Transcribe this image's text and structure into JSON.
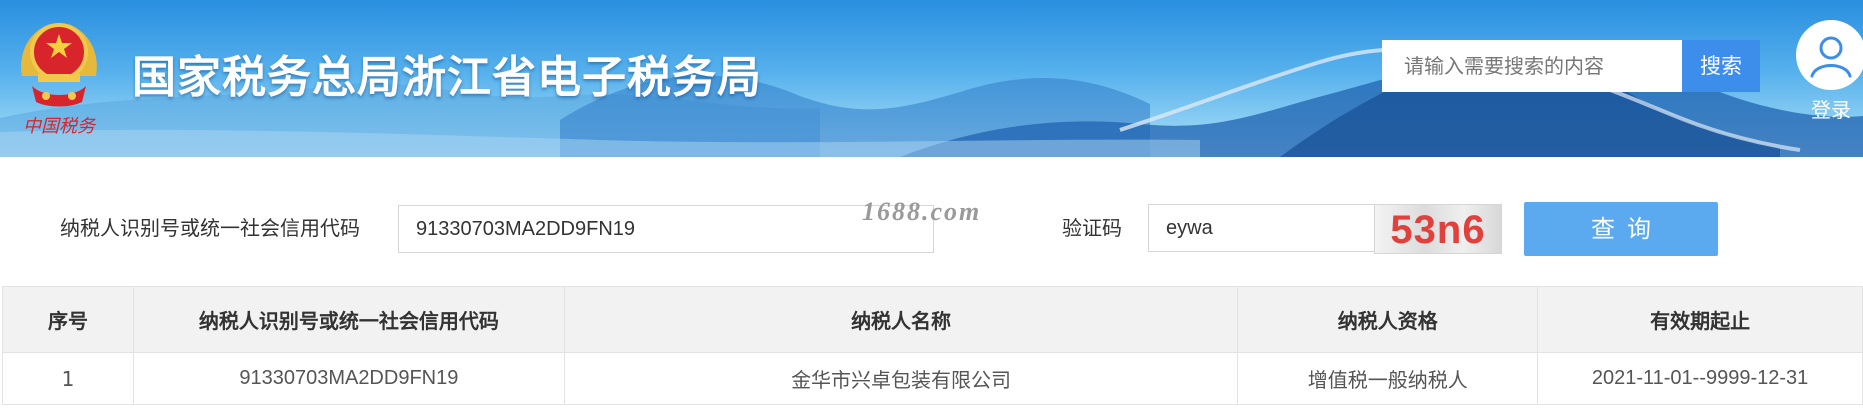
{
  "header": {
    "site_title": "国家税务总局浙江省电子税务局",
    "emblem_slogan": "中国税务",
    "search": {
      "placeholder": "请输入需要搜索的内容",
      "value": ""
    },
    "search_button": "搜索",
    "login_label": "登录",
    "colors": {
      "banner_top": "#2a8fe0",
      "banner_bottom": "#b6e1f8",
      "search_button": "#3d8eea"
    }
  },
  "query_form": {
    "taxpayer_id_label": "纳税人识别号或统一社会信用代码",
    "taxpayer_id_value": "91330703MA2DD9FN19",
    "watermark": "1688.com",
    "captcha_label": "验证码",
    "captcha_value": "eywa",
    "captcha_image_text": "53n6",
    "query_button": "查询",
    "colors": {
      "query_button": "#5baaf0",
      "captcha_text": "#e0413c"
    }
  },
  "results": {
    "columns": [
      "序号",
      "纳税人识别号或统一社会信用代码",
      "纳税人名称",
      "纳税人资格",
      "有效期起止"
    ],
    "rows": [
      [
        "1",
        "91330703MA2DD9FN19",
        "金华市兴卓包装有限公司",
        "增值税一般纳税人",
        "2021-11-01--9999-12-31"
      ]
    ]
  },
  "icons": {
    "emblem": "national-emblem-icon",
    "login": "user-avatar-icon"
  }
}
